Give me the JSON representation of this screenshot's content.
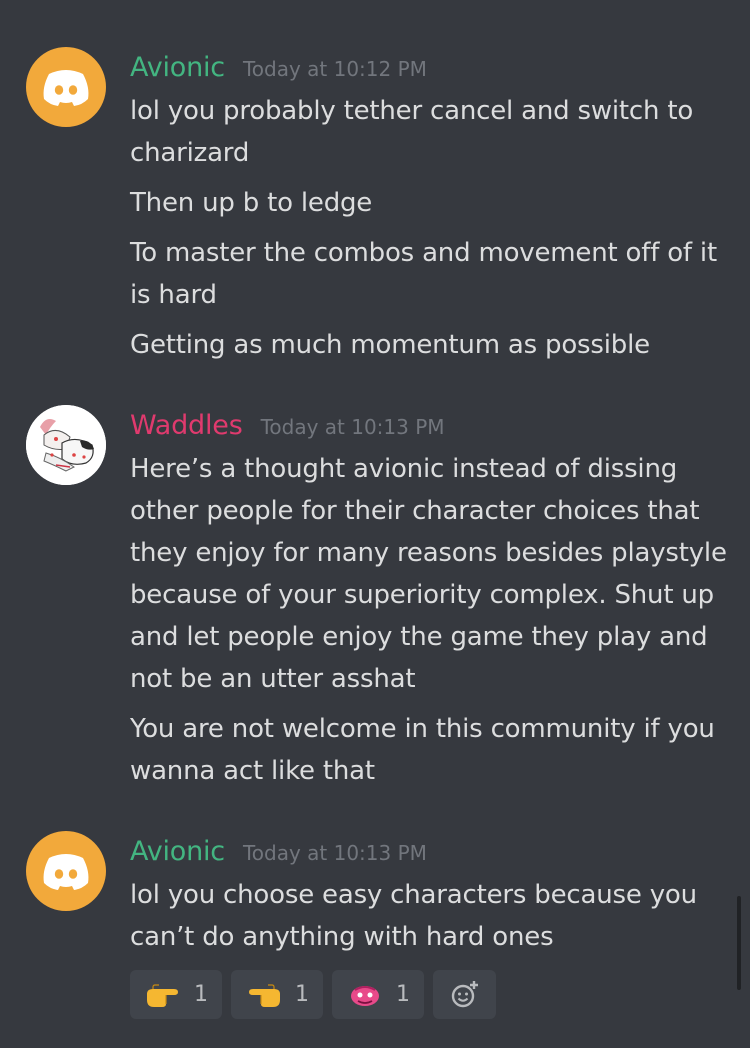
{
  "messages": [
    {
      "author": "Avionic",
      "author_color": "#43b581",
      "timestamp": "Today at 10:12 PM",
      "avatar_icon": "discord-logo-icon",
      "lines": [
        "lol you probably tether cancel and switch to charizard",
        "Then up b to ledge",
        "To master the combos and movement off of it is hard",
        "Getting as much momentum as possible"
      ]
    },
    {
      "author": "Waddles",
      "author_color": "#e03a6e",
      "timestamp": "Today at 10:13 PM",
      "avatar_icon": "character-illustration-icon",
      "lines": [
        "Here’s a thought avionic instead of dissing other people for their character choices that they enjoy for many reasons besides playstyle because of your superiority complex. Shut up and let people enjoy the game they play and not be an utter asshat",
        "You are not welcome in this community if you wanna act like that"
      ]
    },
    {
      "author": "Avionic",
      "author_color": "#43b581",
      "timestamp": "Today at 10:13 PM",
      "avatar_icon": "discord-logo-icon",
      "lines": [
        "lol you choose easy characters because you can’t do anything with hard ones"
      ],
      "reactions": [
        {
          "emoji": "pointing-right-hand-icon",
          "count": "1"
        },
        {
          "emoji": "pointing-left-hand-icon",
          "count": "1"
        },
        {
          "emoji": "custom-emoji-icon",
          "count": "1"
        }
      ],
      "add_reaction_icon": "add-reaction-smiley-icon"
    }
  ],
  "colors": {
    "background": "#36393f",
    "text": "#dcddde",
    "timestamp": "#72767d",
    "reaction_bg": "#40444b",
    "discord_avatar": "#f2a93b"
  }
}
